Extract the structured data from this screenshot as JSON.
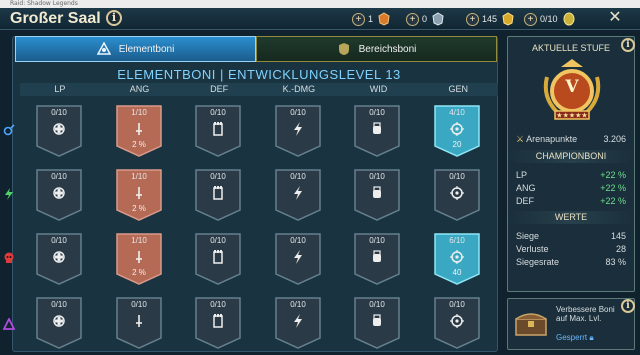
{
  "window_title": "Raid: Shadow Legends",
  "header": {
    "title": "Großer Saal",
    "resources": [
      {
        "value": "1",
        "icon": "orange-medal-icon"
      },
      {
        "value": "0",
        "icon": "silver-medal-icon"
      },
      {
        "value": "145",
        "icon": "gold-medal-icon"
      },
      {
        "value": "0/10",
        "icon": "gold-coin-icon"
      }
    ]
  },
  "tabs": [
    {
      "label": "Elementboni",
      "active": true
    },
    {
      "label": "Bereichsboni",
      "active": false
    }
  ],
  "heading": "ELEMENTBONI | ENTWICKLUNGSLEVEL 13",
  "columns": [
    "LP",
    "ANG",
    "DEF",
    "K.-DMG",
    "WID",
    "GEN"
  ],
  "rows": [
    {
      "element": "magic-element-icon",
      "cells": [
        {
          "level": "0/10",
          "bonus": "",
          "state": "locked"
        },
        {
          "level": "1/10",
          "bonus": "2 %",
          "state": "bronze"
        },
        {
          "level": "0/10",
          "bonus": "",
          "state": "locked"
        },
        {
          "level": "0/10",
          "bonus": "",
          "state": "locked"
        },
        {
          "level": "0/10",
          "bonus": "",
          "state": "locked"
        },
        {
          "level": "4/10",
          "bonus": "20",
          "state": "blue"
        }
      ]
    },
    {
      "element": "spirit-element-icon",
      "cells": [
        {
          "level": "0/10",
          "bonus": "",
          "state": "locked"
        },
        {
          "level": "1/10",
          "bonus": "2 %",
          "state": "bronze"
        },
        {
          "level": "0/10",
          "bonus": "",
          "state": "locked"
        },
        {
          "level": "0/10",
          "bonus": "",
          "state": "locked"
        },
        {
          "level": "0/10",
          "bonus": "",
          "state": "locked"
        },
        {
          "level": "0/10",
          "bonus": "",
          "state": "locked"
        }
      ]
    },
    {
      "element": "force-element-icon",
      "cells": [
        {
          "level": "0/10",
          "bonus": "",
          "state": "locked"
        },
        {
          "level": "1/10",
          "bonus": "2 %",
          "state": "bronze"
        },
        {
          "level": "0/10",
          "bonus": "",
          "state": "locked"
        },
        {
          "level": "0/10",
          "bonus": "",
          "state": "locked"
        },
        {
          "level": "0/10",
          "bonus": "",
          "state": "locked"
        },
        {
          "level": "6/10",
          "bonus": "40",
          "state": "blue"
        }
      ]
    },
    {
      "element": "void-element-icon",
      "cells": [
        {
          "level": "0/10",
          "bonus": "",
          "state": "locked"
        },
        {
          "level": "0/10",
          "bonus": "",
          "state": "locked"
        },
        {
          "level": "0/10",
          "bonus": "",
          "state": "locked"
        },
        {
          "level": "0/10",
          "bonus": "",
          "state": "locked"
        },
        {
          "level": "0/10",
          "bonus": "",
          "state": "locked"
        },
        {
          "level": "0/10",
          "bonus": "",
          "state": "locked"
        }
      ]
    }
  ],
  "stat_icons": [
    "hp-icon",
    "attack-icon",
    "defense-icon",
    "crit-damage-icon",
    "resistance-icon",
    "accuracy-icon"
  ],
  "sidebar": {
    "current_rank_title": "AKTUELLE STUFE",
    "rank_letter": "V",
    "arena_points_label": "Arenapunkte",
    "arena_points": "3.206",
    "champion_bonus_title": "CHAMPIONBONI",
    "bonuses": [
      {
        "label": "LP",
        "value": "+22 %"
      },
      {
        "label": "ANG",
        "value": "+22 %"
      },
      {
        "label": "DEF",
        "value": "+22 %"
      }
    ],
    "values_title": "WERTE",
    "stats": [
      {
        "label": "Siege",
        "value": "145"
      },
      {
        "label": "Verluste",
        "value": "28"
      },
      {
        "label": "Siegesrate",
        "value": "83 %"
      }
    ]
  },
  "upgrade": {
    "text_line1": "Verbessere Boni",
    "text_line2": "auf Max. Lvl.",
    "status": "Gesperrt"
  },
  "colors": {
    "bronze": "#b46a55",
    "blue": "#3aa7c3",
    "locked": "#2a3b47",
    "accent": "#7fd2ff",
    "green": "#6fe08b"
  }
}
